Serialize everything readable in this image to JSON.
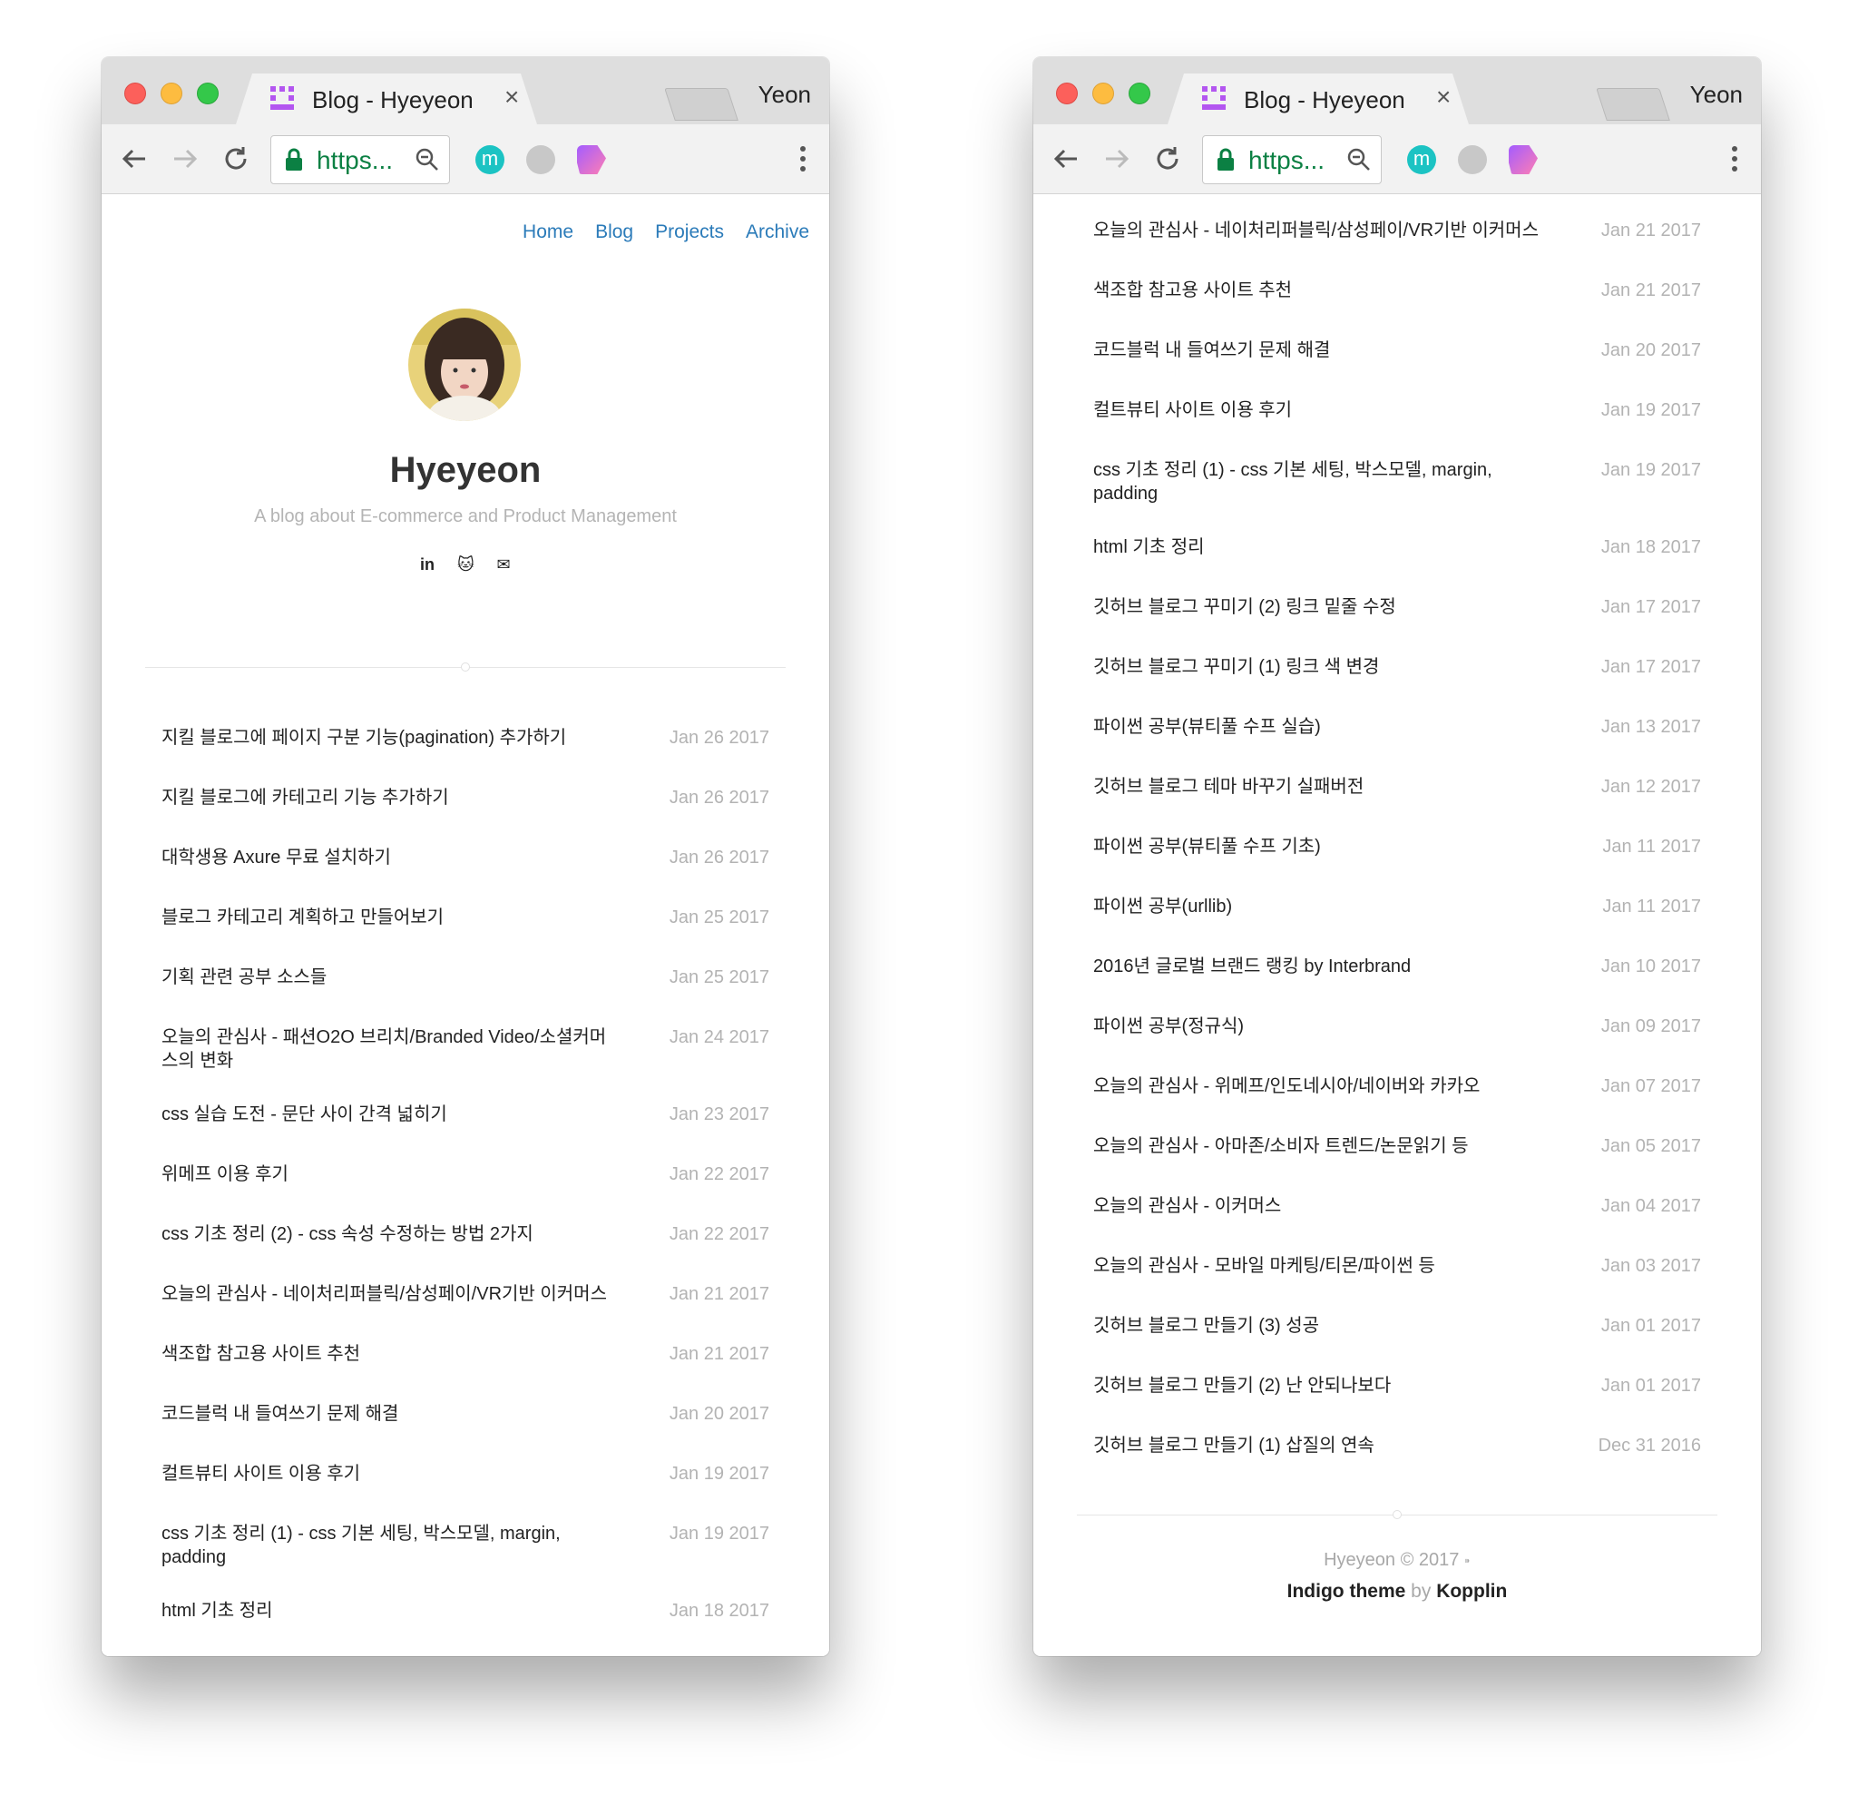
{
  "browser": {
    "tab_title": "Blog - Hyeyeon",
    "close_glyph": "×",
    "profile_name": "Yeon",
    "url_display": "https...",
    "extension_m_label": "m"
  },
  "blog": {
    "nav": [
      "Home",
      "Blog",
      "Projects",
      "Archive"
    ],
    "title": "Hyeyeon",
    "description": "A blog about E-commerce and Product Management",
    "social": [
      {
        "name": "linkedin-icon",
        "glyph": "in"
      },
      {
        "name": "github-icon",
        "glyph": "🐱"
      },
      {
        "name": "email-icon",
        "glyph": "✉"
      }
    ],
    "posts": [
      {
        "title": "지킬 블로그에 페이지 구분 기능(pagination) 추가하기",
        "date": "Jan 26 2017"
      },
      {
        "title": "지킬 블로그에 카테고리 기능 추가하기",
        "date": "Jan 26 2017"
      },
      {
        "title": "대학생용 Axure 무료 설치하기",
        "date": "Jan 26 2017"
      },
      {
        "title": "블로그 카테고리 계획하고 만들어보기",
        "date": "Jan 25 2017"
      },
      {
        "title": "기획 관련 공부 소스들",
        "date": "Jan 25 2017"
      },
      {
        "title": "오늘의 관심사 - 패션O2O 브리치/Branded Video/소셜커머스의 변화",
        "date": "Jan 24 2017"
      },
      {
        "title": "css 실습 도전 - 문단 사이 간격 넓히기",
        "date": "Jan 23 2017"
      },
      {
        "title": "위메프 이용 후기",
        "date": "Jan 22 2017"
      },
      {
        "title": "css 기초 정리 (2) - css 속성 수정하는 방법 2가지",
        "date": "Jan 22 2017"
      },
      {
        "title": "오늘의 관심사 - 네이처리퍼블릭/삼성페이/VR기반 이커머스",
        "date": "Jan 21 2017"
      },
      {
        "title": "색조합 참고용 사이트 추천",
        "date": "Jan 21 2017"
      },
      {
        "title": "코드블럭 내 들여쓰기 문제 해결",
        "date": "Jan 20 2017"
      },
      {
        "title": "컬트뷰티 사이트 이용 후기",
        "date": "Jan 19 2017"
      },
      {
        "title": "css 기초 정리 (1) - css 기본 세팅, 박스모델, margin, padding",
        "date": "Jan 19 2017"
      },
      {
        "title": "html 기초 정리",
        "date": "Jan 18 2017"
      },
      {
        "title": "깃허브 블로그 꾸미기 (2) 링크 밑줄 수정",
        "date": "Jan 17 2017"
      },
      {
        "title": "깃허브 블로그 꾸미기 (1) 링크 색 변경",
        "date": "Jan 17 2017"
      },
      {
        "title": "파이썬 공부(뷰티풀 수프 실습)",
        "date": "Jan 13 2017"
      },
      {
        "title": "깃허브 블로그 테마 바꾸기 실패버전",
        "date": "Jan 12 2017"
      },
      {
        "title": "파이썬 공부(뷰티풀 수프 기초)",
        "date": "Jan 11 2017"
      },
      {
        "title": "파이썬 공부(urllib)",
        "date": "Jan 11 2017"
      },
      {
        "title": "2016년 글로벌 브랜드 랭킹 by Interbrand",
        "date": "Jan 10 2017"
      },
      {
        "title": "파이썬 공부(정규식)",
        "date": "Jan 09 2017"
      },
      {
        "title": "오늘의 관심사 - 위메프/인도네시아/네이버와 카카오",
        "date": "Jan 07 2017"
      },
      {
        "title": "오늘의 관심사 - 아마존/소비자 트렌드/논문읽기 등",
        "date": "Jan 05 2017"
      },
      {
        "title": "오늘의 관심사 - 이커머스",
        "date": "Jan 04 2017"
      },
      {
        "title": "오늘의 관심사 - 모바일 마케팅/티몬/파이썬 등",
        "date": "Jan 03 2017"
      },
      {
        "title": "깃허브 블로그 만들기 (3) 성공",
        "date": "Jan 01 2017"
      },
      {
        "title": "깃허브 블로그 만들기 (2) 난 안되나보다",
        "date": "Jan 01 2017"
      },
      {
        "title": "깃허브 블로그 만들기 (1) 삽질의 연속",
        "date": "Dec 31 2016"
      }
    ],
    "footer": {
      "copyright": "Hyeyeon © 2017",
      "rss_glyph": "⁍",
      "theme": "Indigo theme",
      "by": "by",
      "author": "Kopplin"
    }
  },
  "colors": {
    "nav_link": "#2b7bb9",
    "url_green": "#0b8043",
    "date_gray": "#b3b3b3"
  }
}
